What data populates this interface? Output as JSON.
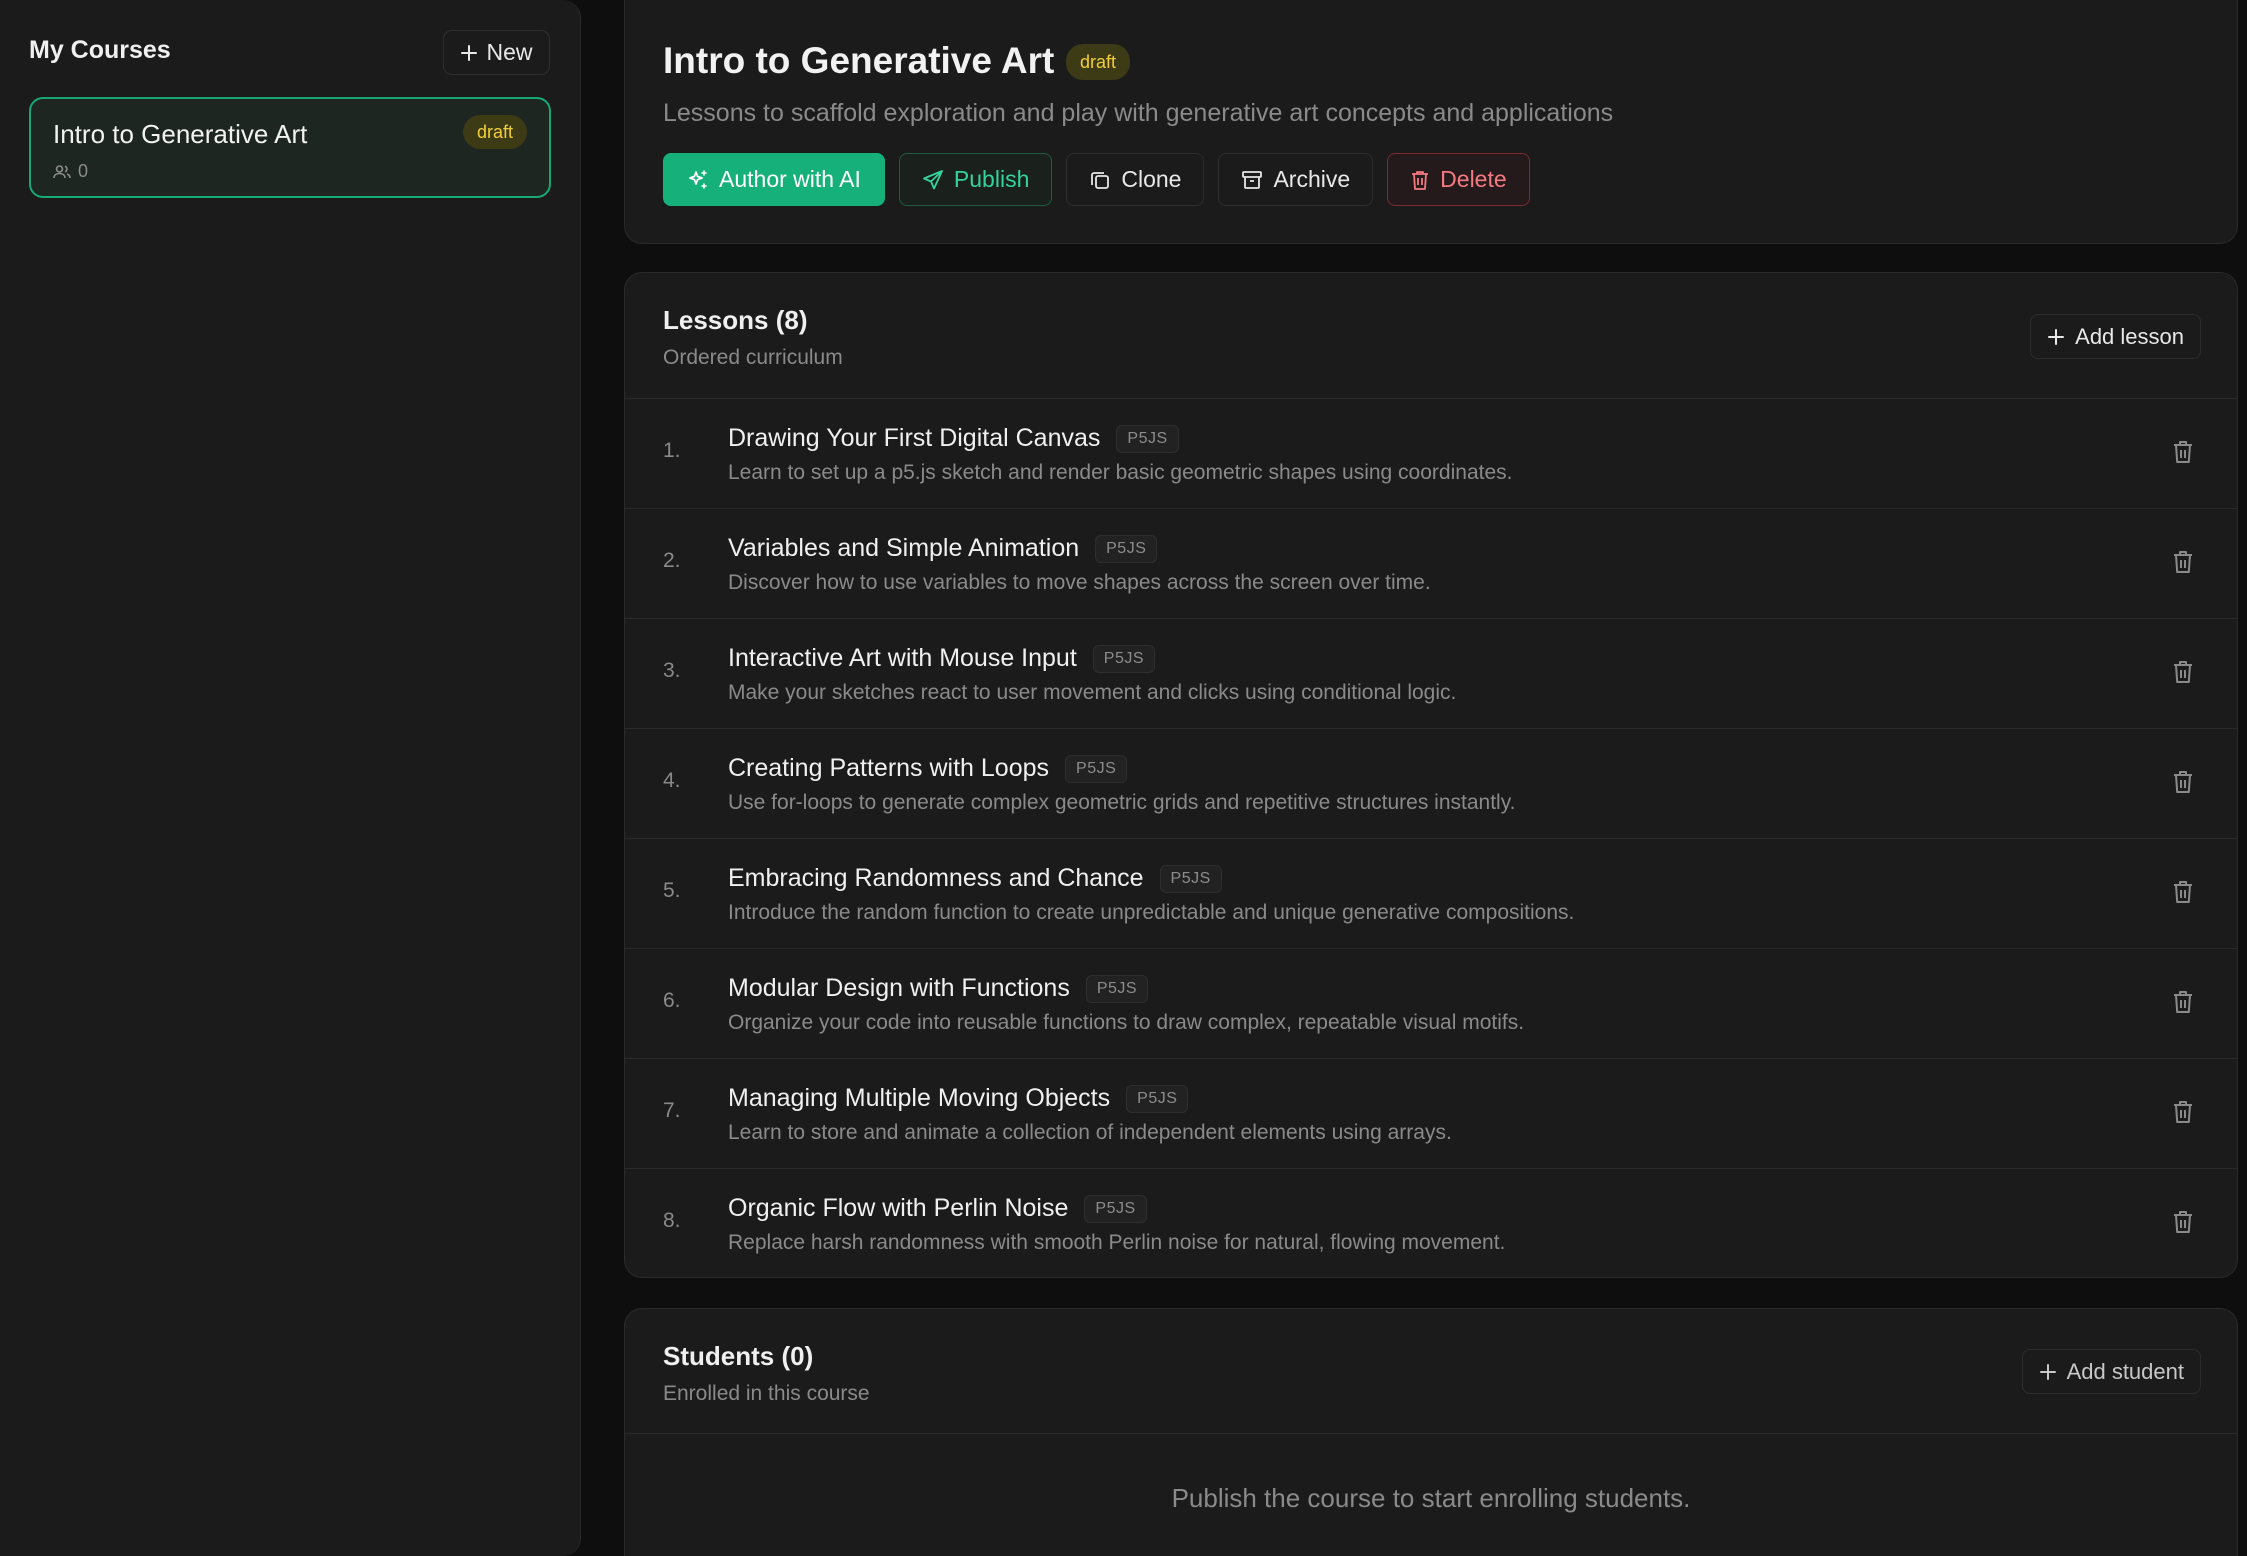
{
  "sidebar": {
    "title": "My Courses",
    "new_label": "New",
    "courses": [
      {
        "name": "Intro to Generative Art",
        "status": "draft",
        "students": "0"
      }
    ]
  },
  "course": {
    "title": "Intro to Generative Art",
    "status": "draft",
    "description": "Lessons to scaffold exploration and play with generative art concepts and applications",
    "actions": {
      "author_ai": "Author with AI",
      "publish": "Publish",
      "clone": "Clone",
      "archive": "Archive",
      "delete": "Delete"
    }
  },
  "lessons": {
    "title": "Lessons (8)",
    "subtitle": "Ordered curriculum",
    "add_label": "Add lesson",
    "items": [
      {
        "num": "1.",
        "title": "Drawing Your First Digital Canvas",
        "tag": "P5JS",
        "desc": "Learn to set up a p5.js sketch and render basic geometric shapes using coordinates."
      },
      {
        "num": "2.",
        "title": "Variables and Simple Animation",
        "tag": "P5JS",
        "desc": "Discover how to use variables to move shapes across the screen over time."
      },
      {
        "num": "3.",
        "title": "Interactive Art with Mouse Input",
        "tag": "P5JS",
        "desc": "Make your sketches react to user movement and clicks using conditional logic."
      },
      {
        "num": "4.",
        "title": "Creating Patterns with Loops",
        "tag": "P5JS",
        "desc": "Use for-loops to generate complex geometric grids and repetitive structures instantly."
      },
      {
        "num": "5.",
        "title": "Embracing Randomness and Chance",
        "tag": "P5JS",
        "desc": "Introduce the random function to create unpredictable and unique generative compositions."
      },
      {
        "num": "6.",
        "title": "Modular Design with Functions",
        "tag": "P5JS",
        "desc": "Organize your code into reusable functions to draw complex, repeatable visual motifs."
      },
      {
        "num": "7.",
        "title": "Managing Multiple Moving Objects",
        "tag": "P5JS",
        "desc": "Learn to store and animate a collection of independent elements using arrays."
      },
      {
        "num": "8.",
        "title": "Organic Flow with Perlin Noise",
        "tag": "P5JS",
        "desc": "Replace harsh randomness with smooth Perlin noise for natural, flowing movement."
      }
    ]
  },
  "students": {
    "title": "Students (0)",
    "subtitle": "Enrolled in this course",
    "add_label": "Add student",
    "empty": "Publish the course to start enrolling students."
  },
  "icons": {
    "new": "plus-icon",
    "students": "users-icon",
    "author_ai": "sparkles-icon",
    "publish": "send-icon",
    "clone": "copy-icon",
    "archive": "archive-icon",
    "delete": "trash-icon"
  },
  "colors": {
    "accent": "#16b07a",
    "draft_badge_bg": "#3d3a16",
    "draft_badge_text": "#f2cf39",
    "danger": "#f47a80"
  }
}
